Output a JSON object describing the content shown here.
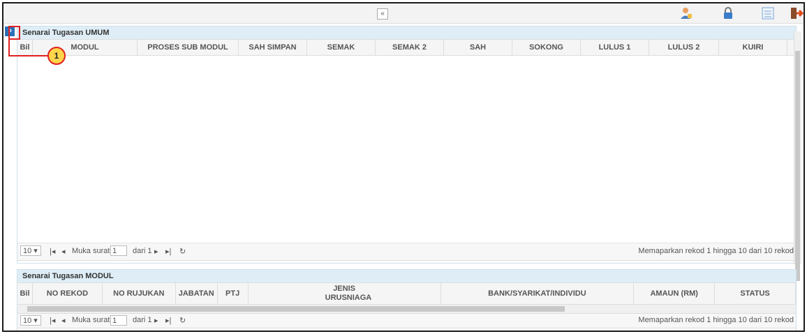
{
  "toolbar": {
    "collapse_glyph": "«",
    "icons": [
      "user-icon",
      "lock-icon",
      "list-icon",
      "logout-icon"
    ]
  },
  "sidebar_toggle_glyph": "»",
  "annotation_number": "1",
  "panel1": {
    "title": "Senarai Tugasan UMUM",
    "columns": [
      "Bil",
      "MODUL",
      "PROSES SUB MODUL",
      "SAH SIMPAN",
      "SEMAK",
      "SEMAK 2",
      "SAH",
      "SOKONG",
      "LULUS 1",
      "LULUS 2",
      "KUIRI"
    ],
    "pager": {
      "page_size": "10",
      "page_label": "Muka surat",
      "page_value": "1",
      "of_label": "dari 1",
      "summary": "Memaparkan rekod 1 hingga 10 dari 10 rekod"
    }
  },
  "panel2": {
    "title": "Senarai Tugasan MODUL",
    "columns": [
      "Bil",
      "NO REKOD",
      "NO RUJUKAN",
      "JABATAN",
      "PTJ",
      "JENIS URUSNIAGA",
      "BANK/SYARIKAT/INDIVIDU",
      "AMAUN (RM)",
      "STATUS"
    ],
    "pager": {
      "page_size": "10",
      "page_label": "Muka surat",
      "page_value": "1",
      "of_label": "dari 1",
      "summary": "Memaparkan rekod 1 hingga 10 dari 10 rekod"
    }
  }
}
